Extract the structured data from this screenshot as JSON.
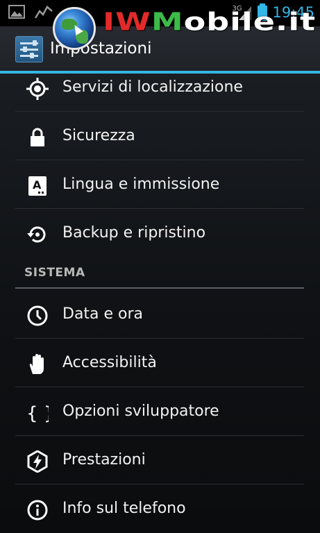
{
  "status_bar": {
    "network": "3G",
    "time": "19:45",
    "icons": [
      "gallery-icon",
      "activity-icon",
      "signal-icon",
      "battery-icon"
    ]
  },
  "watermark": {
    "red_part": "IW",
    "green_part": "M",
    "rest": "obile.it"
  },
  "action_bar": {
    "title": "Impostazioni",
    "icon": "settings-sliders-icon"
  },
  "list": {
    "items_top": [
      {
        "label": "Servizi di localizzazione",
        "icon": "location-target-icon"
      },
      {
        "label": "Sicurezza",
        "icon": "lock-icon"
      },
      {
        "label": "Lingua e immissione",
        "icon": "keyboard-language-icon"
      },
      {
        "label": "Backup e ripristino",
        "icon": "backup-restore-icon"
      }
    ],
    "section_header": "SISTEMA",
    "items_system": [
      {
        "label": "Data e ora",
        "icon": "clock-icon"
      },
      {
        "label": "Accessibilità",
        "icon": "hand-icon"
      },
      {
        "label": "Opzioni sviluppatore",
        "icon": "braces-icon"
      },
      {
        "label": "Prestazioni",
        "icon": "lightning-icon"
      },
      {
        "label": "Info sul telefono",
        "icon": "info-icon"
      }
    ]
  },
  "colors": {
    "accent": "#33b5e5",
    "background": "#111316",
    "text": "#f2f2f2"
  }
}
